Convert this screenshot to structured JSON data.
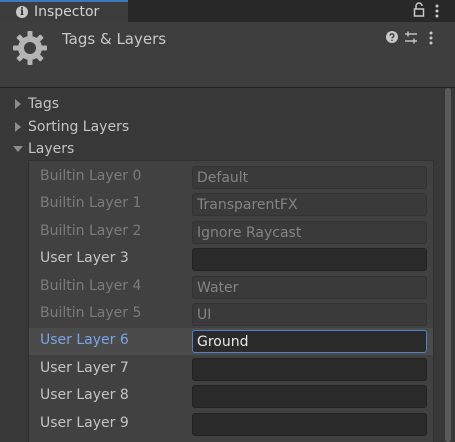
{
  "tab": {
    "title": "Inspector"
  },
  "header": {
    "title": "Tags & Layers"
  },
  "foldouts": [
    {
      "label": "Tags",
      "expanded": false
    },
    {
      "label": "Sorting Layers",
      "expanded": false
    },
    {
      "label": "Layers",
      "expanded": true
    }
  ],
  "layers": [
    {
      "label": "Builtin Layer 0",
      "value": "Default",
      "builtin": true
    },
    {
      "label": "Builtin Layer 1",
      "value": "TransparentFX",
      "builtin": true
    },
    {
      "label": "Builtin Layer 2",
      "value": "Ignore Raycast",
      "builtin": true
    },
    {
      "label": "User Layer 3",
      "value": "",
      "builtin": false
    },
    {
      "label": "Builtin Layer 4",
      "value": "Water",
      "builtin": true
    },
    {
      "label": "Builtin Layer 5",
      "value": "UI",
      "builtin": true
    },
    {
      "label": "User Layer 6",
      "value": "Ground",
      "builtin": false,
      "focused": true
    },
    {
      "label": "User Layer 7",
      "value": "",
      "builtin": false
    },
    {
      "label": "User Layer 8",
      "value": "",
      "builtin": false
    },
    {
      "label": "User Layer 9",
      "value": "",
      "builtin": false
    }
  ],
  "colors": {
    "accent": "#3a79bb",
    "focus_border": "#4b83c8",
    "active_label": "#7aa3e5"
  }
}
